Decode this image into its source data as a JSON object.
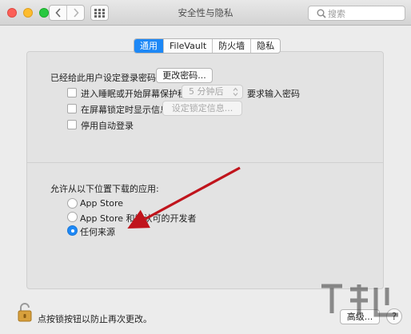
{
  "window": {
    "title": "安全性与隐私",
    "search_placeholder": "搜索"
  },
  "tabs": [
    {
      "label": "通用",
      "active": true
    },
    {
      "label": "FileVault",
      "active": false
    },
    {
      "label": "防火墙",
      "active": false
    },
    {
      "label": "隐私",
      "active": false
    }
  ],
  "general": {
    "login_password_label": "已经给此用户设定登录密码",
    "change_password_button": "更改密码...",
    "require_password": {
      "label": "进入睡眠或开始屏幕保护程序",
      "checked": false,
      "delay_value": "5 分钟后",
      "suffix": "要求输入密码"
    },
    "lock_message": {
      "label": "在屏幕锁定时显示信息",
      "checked": false,
      "button": "设定锁定信息..."
    },
    "disable_auto_login": {
      "label": "停用自动登录",
      "checked": false
    }
  },
  "downloads": {
    "heading": "允许从以下位置下载的应用:",
    "options": [
      {
        "label": "App Store",
        "selected": false
      },
      {
        "label": "App Store 和被认可的开发者",
        "selected": false
      },
      {
        "label": "任何来源",
        "selected": true
      }
    ]
  },
  "footer": {
    "lock_text": "点按锁按钮以防止再次更改。",
    "advanced_button": "高级...",
    "help_label": "?"
  },
  "colors": {
    "accent": "#1d88f6",
    "annotation_arrow": "#c0141c"
  }
}
